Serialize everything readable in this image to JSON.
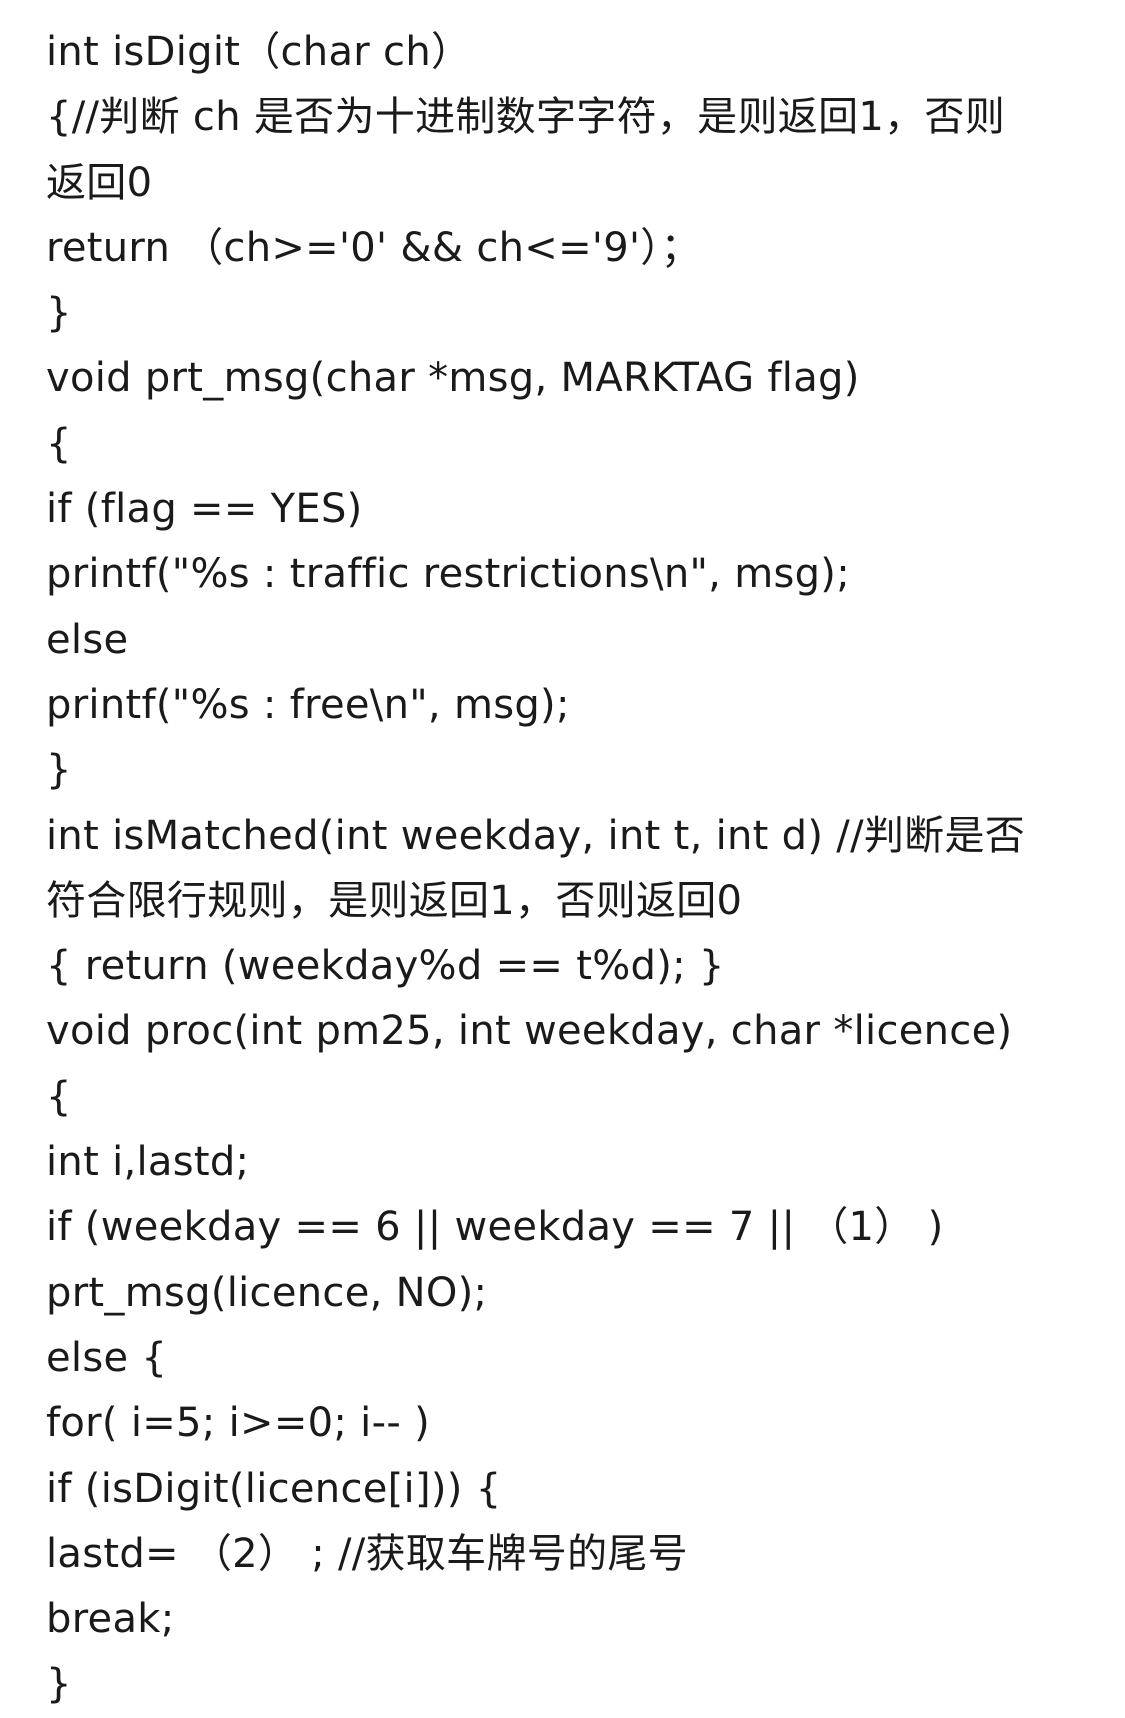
{
  "document": {
    "lines": [
      "int isDigit（char ch）",
      "{//判断 ch 是否为十进制数字字符，是则返回1，否则",
      "返回0",
      "return （ch>='0' && ch<='9'）；",
      "}",
      "void prt_msg(char *msg, MARKTAG flag)",
      "{",
      "if (flag == YES)",
      "printf(\"%s : traffic restrictions\\n\", msg);",
      "else",
      "printf(\"%s : free\\n\", msg);",
      "}",
      "int isMatched(int weekday, int t, int d) //判断是否",
      "符合限行规则，是则返回1，否则返回0",
      "{ return (weekday%d == t%d); }",
      "void proc(int pm25, int weekday, char *licence)",
      "{",
      "int i,lastd;",
      "if (weekday == 6 || weekday == 7 || （1） )",
      "prt_msg(licence, NO);",
      "else {",
      "for( i=5; i>=0; i-- )",
      "if (isDigit(licence[i])) {",
      "lastd= （2） ; //获取车牌号的尾号",
      "break;",
      "}"
    ]
  }
}
